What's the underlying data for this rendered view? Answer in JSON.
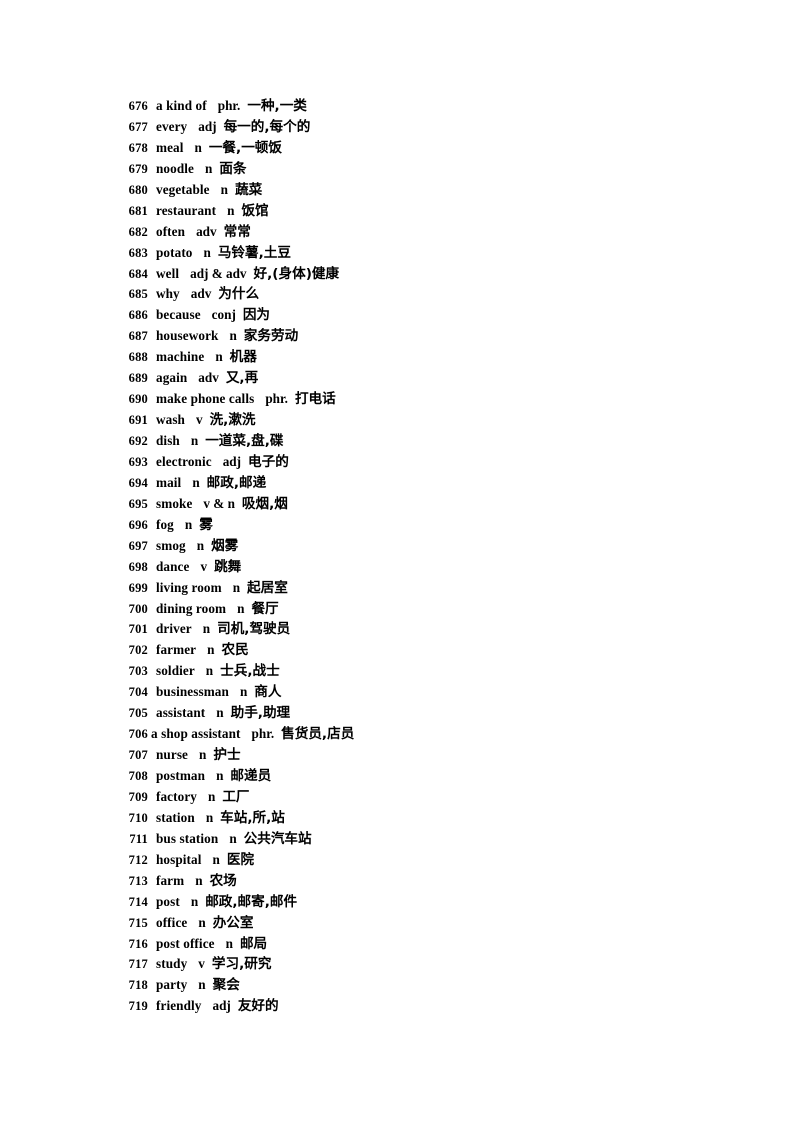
{
  "document": {
    "title": "Vocabulary List 676-719",
    "page_background": "#ffffff",
    "text_color": "#000000"
  },
  "entries": [
    {
      "num": "676",
      "word": "a kind of",
      "pos": "phr.",
      "def": "一种,一类",
      "gap": "normal"
    },
    {
      "num": "677",
      "word": "every",
      "pos": "adj",
      "def": "每一的,每个的",
      "gap": "normal"
    },
    {
      "num": "678",
      "word": "meal",
      "pos": "n",
      "def": "一餐,一顿饭",
      "gap": "normal"
    },
    {
      "num": "679",
      "word": "noodle",
      "pos": "n",
      "def": "面条",
      "gap": "normal"
    },
    {
      "num": "680",
      "word": "vegetable",
      "pos": "n",
      "def": "蔬菜",
      "gap": "normal"
    },
    {
      "num": "681",
      "word": "restaurant",
      "pos": "n",
      "def": "饭馆",
      "gap": "normal"
    },
    {
      "num": "682",
      "word": "often",
      "pos": "adv",
      "def": "常常",
      "gap": "normal"
    },
    {
      "num": "683",
      "word": "potato",
      "pos": "n",
      "def": "马铃薯,土豆",
      "gap": "normal"
    },
    {
      "num": "684",
      "word": "well",
      "pos": "adj & adv",
      "def": "好,(身体)健康",
      "gap": "normal"
    },
    {
      "num": "685",
      "word": "why",
      "pos": "adv",
      "def": "为什么",
      "gap": "normal"
    },
    {
      "num": "686",
      "word": "because",
      "pos": "conj",
      "def": "因为",
      "gap": "normal"
    },
    {
      "num": "687",
      "word": "housework",
      "pos": "n",
      "def": "家务劳动",
      "gap": "normal"
    },
    {
      "num": "688",
      "word": "machine",
      "pos": "n",
      "def": "机器",
      "gap": "normal"
    },
    {
      "num": "689",
      "word": "again",
      "pos": "adv",
      "def": "又,再",
      "gap": "normal"
    },
    {
      "num": "690",
      "word": "make phone calls",
      "pos": "phr.",
      "def": "打电话",
      "gap": "normal"
    },
    {
      "num": "691",
      "word": "wash",
      "pos": "v",
      "def": "洗,漱洗",
      "gap": "normal"
    },
    {
      "num": "692",
      "word": "dish",
      "pos": "n",
      "def": "一道菜,盘,碟",
      "gap": "normal"
    },
    {
      "num": "693",
      "word": "electronic",
      "pos": "adj",
      "def": "电子的",
      "gap": "normal"
    },
    {
      "num": "694",
      "word": "mail",
      "pos": "n",
      "def": "邮政,邮递",
      "gap": "normal"
    },
    {
      "num": "695",
      "word": "smoke",
      "pos": "v & n",
      "def": "吸烟,烟",
      "gap": "normal"
    },
    {
      "num": "696",
      "word": "fog",
      "pos": "n",
      "def": "雾",
      "gap": "normal"
    },
    {
      "num": "697",
      "word": "smog",
      "pos": "n",
      "def": "烟雾",
      "gap": "normal"
    },
    {
      "num": "698",
      "word": "dance",
      "pos": "v",
      "def": "跳舞",
      "gap": "normal"
    },
    {
      "num": "699",
      "word": "living room",
      "pos": "n",
      "def": "起居室",
      "gap": "normal"
    },
    {
      "num": "700",
      "word": "dining room",
      "pos": "n",
      "def": "餐厅",
      "gap": "normal"
    },
    {
      "num": "701",
      "word": "driver",
      "pos": "n",
      "def": "司机,驾驶员",
      "gap": "normal"
    },
    {
      "num": "702",
      "word": "farmer",
      "pos": "n",
      "def": "农民",
      "gap": "normal"
    },
    {
      "num": "703",
      "word": "soldier",
      "pos": "n",
      "def": "士兵,战士",
      "gap": "normal"
    },
    {
      "num": "704",
      "word": "businessman",
      "pos": "n",
      "def": "商人",
      "gap": "normal"
    },
    {
      "num": "705",
      "word": "assistant",
      "pos": "n",
      "def": "助手,助理",
      "gap": "normal"
    },
    {
      "num": "706",
      "word": "a shop assistant",
      "pos": "phr.",
      "def": "售货员,店员",
      "gap": "tight"
    },
    {
      "num": "707",
      "word": "nurse",
      "pos": "n",
      "def": "护士",
      "gap": "normal"
    },
    {
      "num": "708",
      "word": "postman",
      "pos": "n",
      "def": "邮递员",
      "gap": "normal"
    },
    {
      "num": "709",
      "word": "factory",
      "pos": "n",
      "def": "工厂",
      "gap": "normal"
    },
    {
      "num": "710",
      "word": "station",
      "pos": "n",
      "def": "车站,所,站",
      "gap": "normal"
    },
    {
      "num": "711",
      "word": "bus station",
      "pos": "n",
      "def": "公共汽车站",
      "gap": "normal"
    },
    {
      "num": "712",
      "word": "hospital",
      "pos": "n",
      "def": "医院",
      "gap": "normal"
    },
    {
      "num": "713",
      "word": "farm",
      "pos": "n",
      "def": "农场",
      "gap": "normal"
    },
    {
      "num": "714",
      "word": "post",
      "pos": "n",
      "def": "邮政,邮寄,邮件",
      "gap": "normal"
    },
    {
      "num": "715",
      "word": "office",
      "pos": "n",
      "def": "办公室",
      "gap": "normal"
    },
    {
      "num": "716",
      "word": "post office",
      "pos": "n",
      "def": "邮局",
      "gap": "normal"
    },
    {
      "num": "717",
      "word": "study",
      "pos": "v",
      "def": "学习,研究",
      "gap": "normal"
    },
    {
      "num": "718",
      "word": "party",
      "pos": "n",
      "def": "聚会",
      "gap": "normal"
    },
    {
      "num": "719",
      "word": "friendly",
      "pos": "adj",
      "def": "友好的",
      "gap": "normal"
    }
  ]
}
